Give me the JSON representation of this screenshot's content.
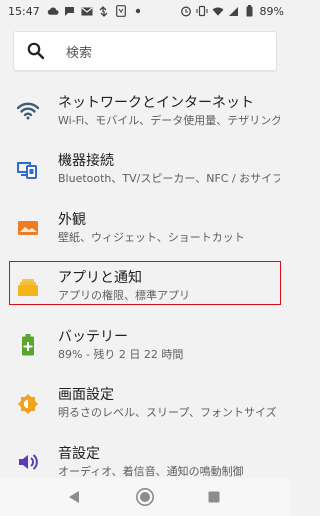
{
  "status_bar": {
    "time": "15:47",
    "left_icons": [
      "cloud-icon",
      "chat-bubble-icon",
      "mail-icon",
      "swap-arrows-icon",
      "app-icon",
      "dot-icon"
    ],
    "right_icons": [
      "alarm-icon",
      "vibrate-icon",
      "wifi-icon",
      "signal-icon",
      "battery-icon"
    ],
    "battery_percent": "89%"
  },
  "search": {
    "placeholder": "検索"
  },
  "settings": {
    "items": [
      {
        "title": "ネットワークとインターネット",
        "subtitle": "Wi-Fi、モバイル、データ使用量、テザリング",
        "icon": "wifi-icon",
        "color": "#3f5d75"
      },
      {
        "title": "機器接続",
        "subtitle": "Bluetooth、TV/スピーカー、NFC / おサイフケータイ",
        "icon": "devices-icon",
        "color": "#2e6cc9"
      },
      {
        "title": "外観",
        "subtitle": "壁紙、ウィジェット、ショートカット",
        "icon": "wallpaper-icon",
        "color": "#ef7b25"
      },
      {
        "title": "アプリと通知",
        "subtitle": "アプリの権限、標準アプリ",
        "icon": "apps-icon",
        "color": "#f5b417"
      },
      {
        "title": "バッテリー",
        "subtitle": "89% - 残り 2 日 22 時間",
        "icon": "battery-icon",
        "color": "#5aa62d"
      },
      {
        "title": "画面設定",
        "subtitle": "明るさのレベル、スリープ、フォントサイズ",
        "icon": "brightness-icon",
        "color": "#f0a21c"
      },
      {
        "title": "音設定",
        "subtitle": "オーディオ、着信音、通知の鳴動制御",
        "icon": "volume-icon",
        "color": "#5b3bb5"
      }
    ]
  },
  "nav_bar": {
    "back": "back-icon",
    "home": "home-icon",
    "recents": "recents-icon"
  }
}
